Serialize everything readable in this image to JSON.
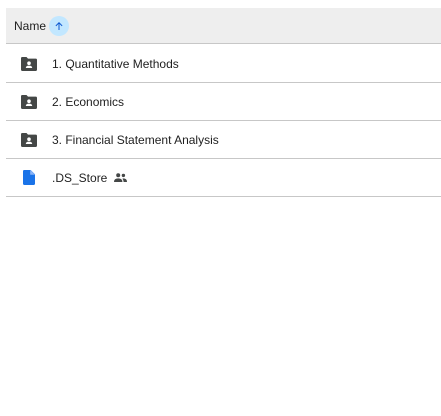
{
  "header": {
    "name_label": "Name",
    "sort_direction": "ascending"
  },
  "files": [
    {
      "name": "1. Quantitative Methods",
      "icon": "shared-folder-icon",
      "shared": false
    },
    {
      "name": "2. Economics",
      "icon": "shared-folder-icon",
      "shared": false
    },
    {
      "name": "3. Financial Statement Analysis",
      "icon": "shared-folder-icon",
      "shared": false
    },
    {
      "name": ".DS_Store",
      "icon": "file-icon",
      "shared": true,
      "shared_icon": "people-icon"
    }
  ],
  "colors": {
    "header_bg": "#eeeeee",
    "sort_badge_bg": "#c2e7ff",
    "sort_arrow": "#0b57d0",
    "folder": "#444746",
    "file": "#1a73e8",
    "divider": "#c7c7c7"
  }
}
